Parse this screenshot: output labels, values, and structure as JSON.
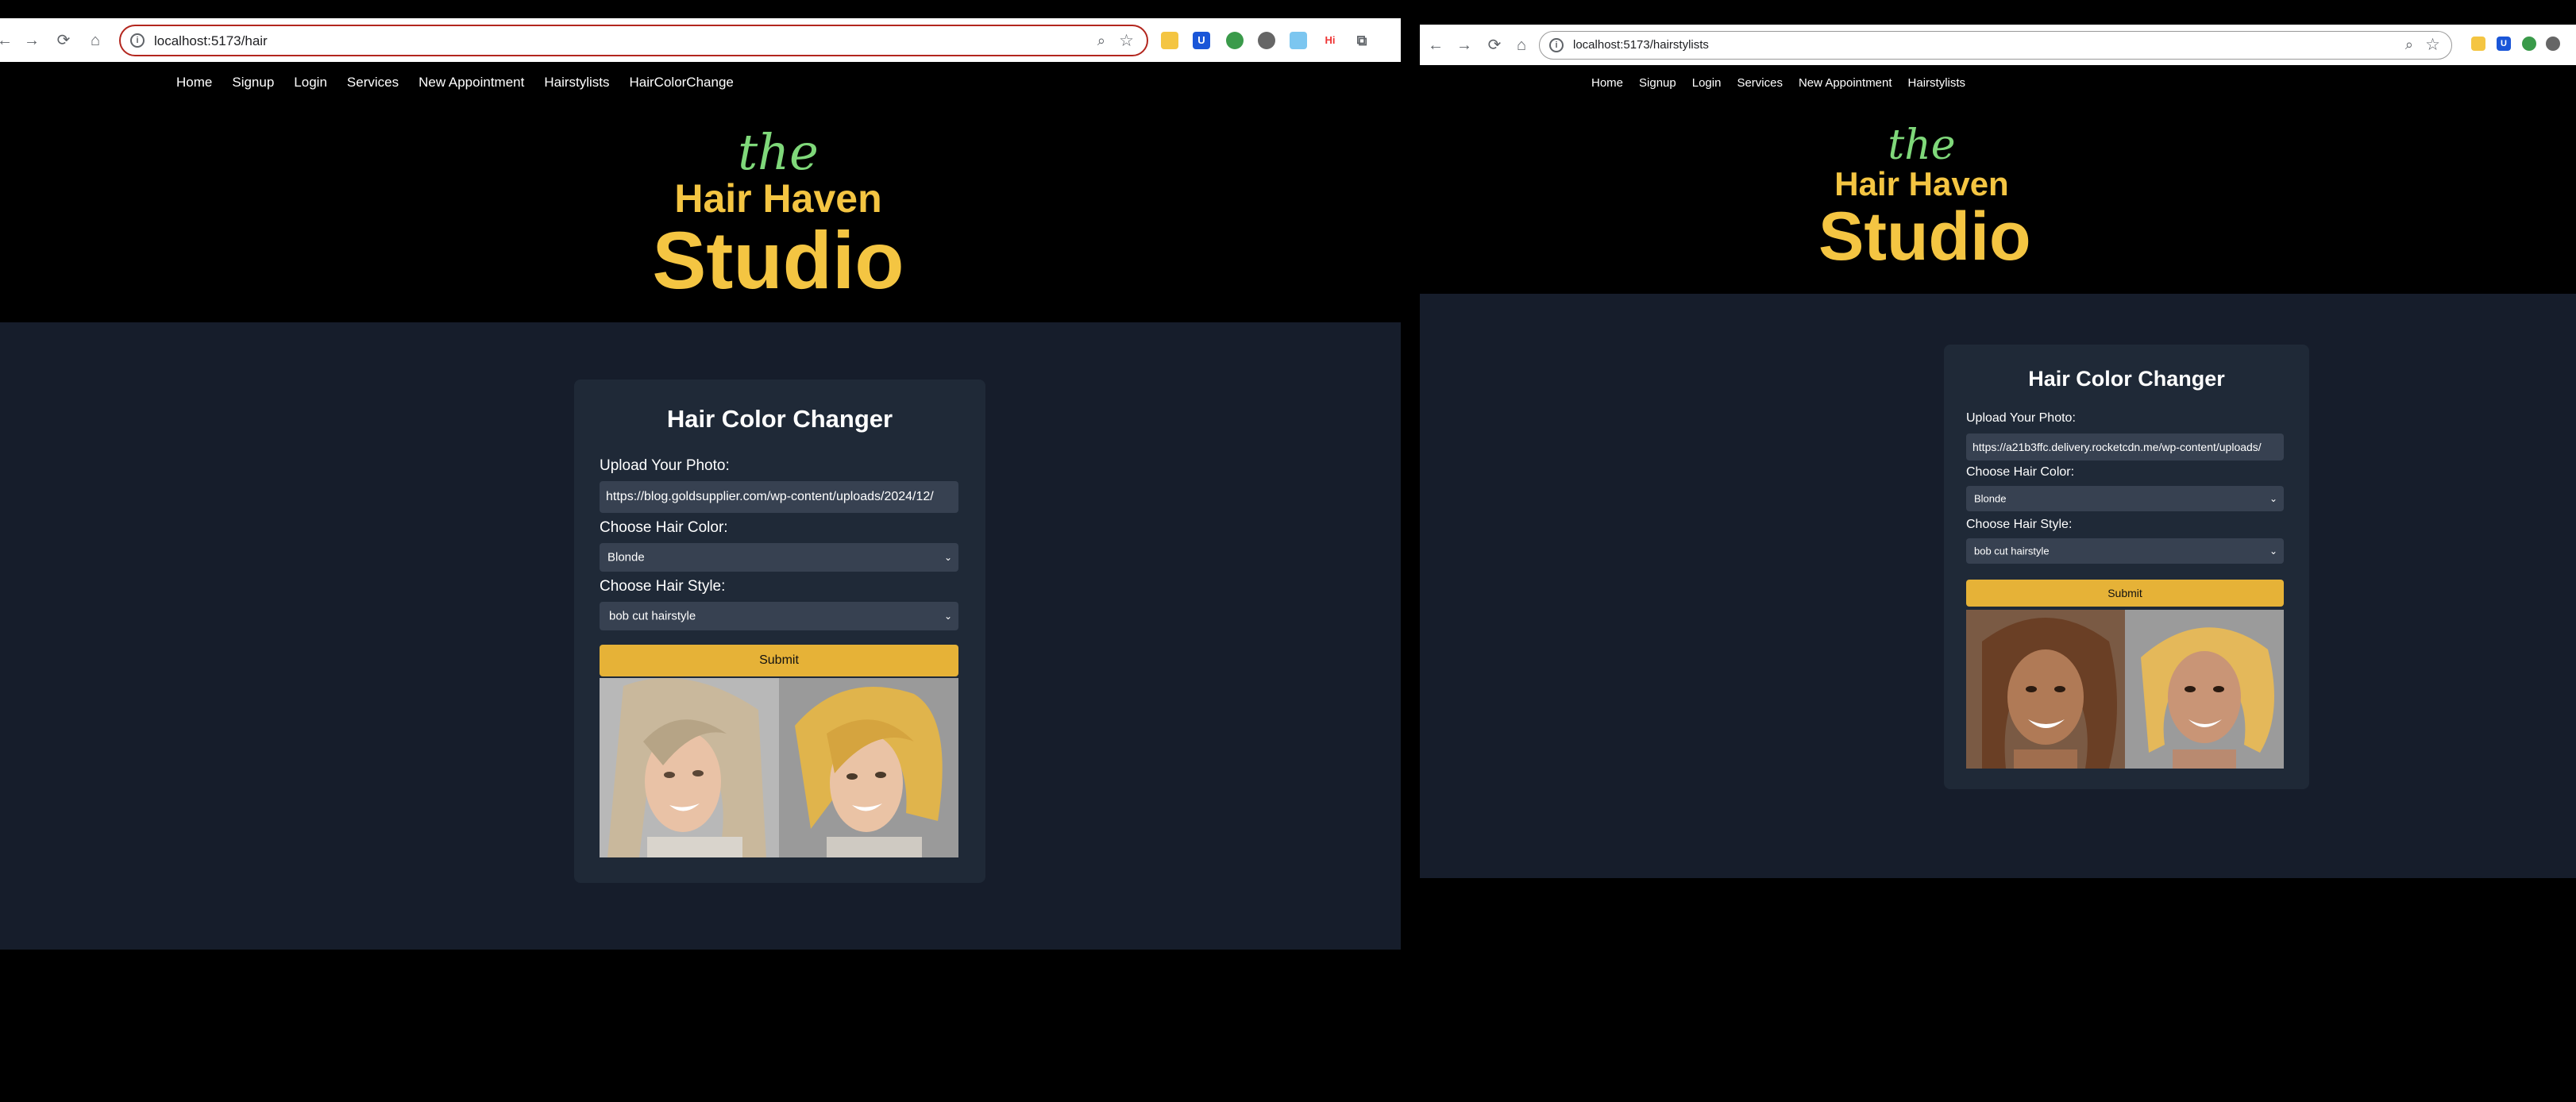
{
  "left_window": {
    "url": "localhost:5173/hair",
    "nav": [
      "Home",
      "Signup",
      "Login",
      "Services",
      "New Appointment",
      "Hairstylists",
      "HairColorChange"
    ],
    "logo": {
      "the": "the",
      "line1": "Hair Haven",
      "line2": "Studio"
    },
    "card": {
      "title": "Hair Color Changer",
      "upload_label": "Upload Your Photo:",
      "upload_value": "https://blog.goldsupplier.com/wp-content/uploads/2024/12/",
      "color_label": "Choose Hair Color:",
      "color_value": "Blonde",
      "style_label": "Choose Hair Style:",
      "style_value": "bob cut hairstyle",
      "submit": "Submit"
    }
  },
  "right_window": {
    "url": "localhost:5173/hairstylists",
    "nav": [
      "Home",
      "Signup",
      "Login",
      "Services",
      "New Appointment",
      "Hairstylists"
    ],
    "logo": {
      "the": "the",
      "line1": "Hair Haven",
      "line2": "Studio"
    },
    "card": {
      "title": "Hair Color Changer",
      "upload_label": "Upload Your Photo:",
      "upload_value": "https://a21b3ffc.delivery.rocketcdn.me/wp-content/uploads/",
      "color_label": "Choose Hair Color:",
      "color_value": "Blonde",
      "style_label": "Choose Hair Style:",
      "style_value": "bob cut hairstyle",
      "submit": "Submit"
    }
  },
  "extension_icons": [
    "U",
    "Hi"
  ],
  "colors": {
    "accent_gold": "#f4c542",
    "accent_green": "#7fd87a",
    "button": "#e6b237",
    "card": "#1f2937",
    "content_bg": "#161d2b"
  }
}
